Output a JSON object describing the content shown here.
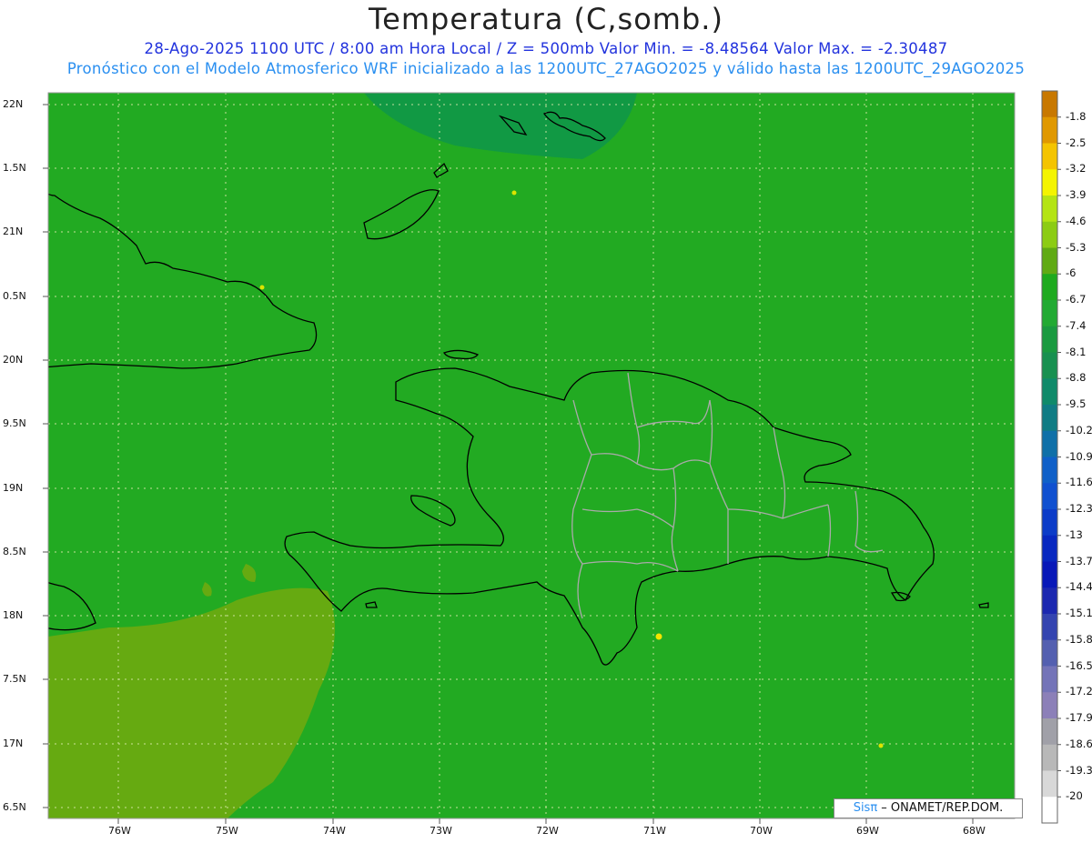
{
  "header": {
    "title": "Temperatura (C,somb.)",
    "subtitle1": "28-Ago-2025  1100 UTC / 8:00 am Hora Local / Z = 500mb  Valor Min. = -8.48564  Valor Max. = -2.30487",
    "subtitle2": "Pronóstico con el Modelo Atmosferico WRF inicializado a las 1200UTC_27AGO2025 y válido hasta las  1200UTC_29AGO2025"
  },
  "map": {
    "lat_labels": [
      "22N",
      "1.5N",
      "21N",
      "0.5N",
      "20N",
      "9.5N",
      "19N",
      "8.5N",
      "18N",
      "7.5N",
      "17N",
      "6.5N"
    ],
    "lon_labels": [
      "76W",
      "75W",
      "74W",
      "73W",
      "72W",
      "71W",
      "70W",
      "69W",
      "68W"
    ],
    "dominant_fill": "#22aa22",
    "warm_fill": "#66aa11",
    "cool_fill": "#119944"
  },
  "colorbar": {
    "levels": [
      "-1.8",
      "-2.5",
      "-3.2",
      "-3.9",
      "-4.6",
      "-5.3",
      "-6",
      "-6.7",
      "-7.4",
      "-8.1",
      "-8.8",
      "-9.5",
      "-10.2",
      "-10.9",
      "-11.6",
      "-12.3",
      "-13",
      "-13.7",
      "-14.4",
      "-15.1",
      "-15.8",
      "-16.5",
      "-17.2",
      "-17.9",
      "-18.6",
      "-19.3",
      "-20"
    ],
    "colors": [
      "#c87800",
      "#e09800",
      "#f4c400",
      "#f4f400",
      "#b4e414",
      "#8ccc14",
      "#60aa14",
      "#1eaa1e",
      "#22aa33",
      "#1a9a40",
      "#189050",
      "#108a6a",
      "#107c84",
      "#1070a8",
      "#1060c8",
      "#1050d0",
      "#0c3cc8",
      "#0828c0",
      "#0818b8",
      "#1c28b0",
      "#3444b0",
      "#5460b0",
      "#7474b8",
      "#8c80b8",
      "#a0a0a8",
      "#b8b8b8",
      "#d8d8d8",
      "#ffffff"
    ]
  },
  "credit": {
    "sis": "Sisπ",
    "text": " – ONAMET/REP.DOM."
  }
}
